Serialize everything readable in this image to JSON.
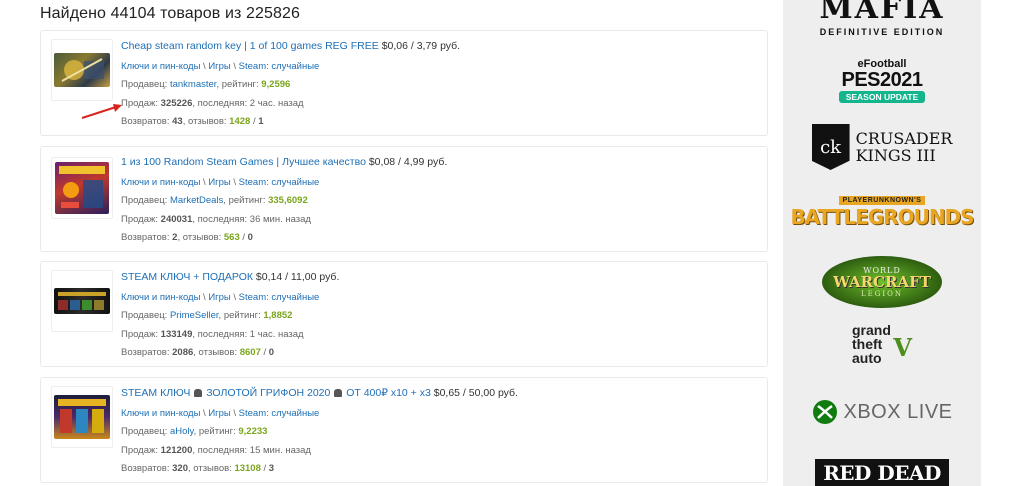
{
  "header": {
    "found_text": "Найдено 44104 товаров из 225826"
  },
  "labels": {
    "seller": "Продавец:",
    "rating": ", рейтинг:",
    "sales": "Продаж:",
    "last": ", последняя:",
    "returns": "Возвратов:",
    "reviews": ", отзывов:",
    "slash": "/",
    "sep": "\\"
  },
  "products": [
    {
      "title": "Cheap steam random key | 1 of 100 games REG FREE",
      "price": "$0,06 / 3,79 руб.",
      "category": [
        "Ключи и пин-коды",
        "Игры",
        "Steam: случайные"
      ],
      "seller": "tankmaster",
      "rating": "9,2596",
      "sales": "325226",
      "last_sale": "2 час. назад",
      "returns": "43",
      "reviews_good": "1428",
      "reviews_bad": "1"
    },
    {
      "title": "1 из 100 Random Steam Games | Лучшее качество",
      "price": "$0,08 / 4,99 руб.",
      "category": [
        "Ключи и пин-коды",
        "Игры",
        "Steam: случайные"
      ],
      "seller": "MarketDeals",
      "rating": "335,6092",
      "sales": "240031",
      "last_sale": "36 мин. назад",
      "returns": "2",
      "reviews_good": "563",
      "reviews_bad": "0"
    },
    {
      "title": "STEAM КЛЮЧ + ПОДАРОК",
      "price": "$0,14 / 11,00 руб.",
      "category": [
        "Ключи и пин-коды",
        "Игры",
        "Steam: случайные"
      ],
      "seller": "PrimeSeller",
      "rating": "1,8852",
      "sales": "133149",
      "last_sale": "1 час. назад",
      "returns": "2086",
      "reviews_good": "8607",
      "reviews_bad": "0"
    },
    {
      "title_a": "STEAM КЛЮЧ",
      "title_b": "ЗОЛОТОЙ ГРИФОН 2020",
      "title_c": "ОТ 400₽ x10 + x3",
      "price": "$0,65 / 50,00 руб.",
      "category": [
        "Ключи и пин-коды",
        "Игры",
        "Steam: случайные"
      ],
      "seller": "aHoly",
      "rating": "9,2233",
      "sales": "121200",
      "last_sale": "15 мин. назад",
      "returns": "320",
      "reviews_good": "13108",
      "reviews_bad": "3"
    }
  ],
  "sidebar": {
    "mafia": {
      "word": "MAFIA",
      "sub": "DEFINITIVE EDITION"
    },
    "pes": {
      "brand": "eFootball",
      "title": "PES2021",
      "badge": "SEASON UPDATE"
    },
    "ck": {
      "monogram": "ck",
      "line1": "CRUSADER",
      "line2": "KINGS III"
    },
    "pubg": {
      "top": "PLAYERUNKNOWN'S",
      "main": "BATTLEGROUNDS"
    },
    "wow": {
      "top": "WORLD",
      "main": "WARCRAFT",
      "sub": "LEGION"
    },
    "gta": {
      "l1": "grand",
      "l2": "theft",
      "l3": "auto",
      "num": "V"
    },
    "xbox": {
      "text": "XBOX LIVE"
    },
    "rdr": {
      "text": "RED DEAD"
    }
  },
  "colors": {
    "link": "#1e6fb5",
    "green": "#7aa51c",
    "sidebar_bg": "#eeeeee"
  }
}
